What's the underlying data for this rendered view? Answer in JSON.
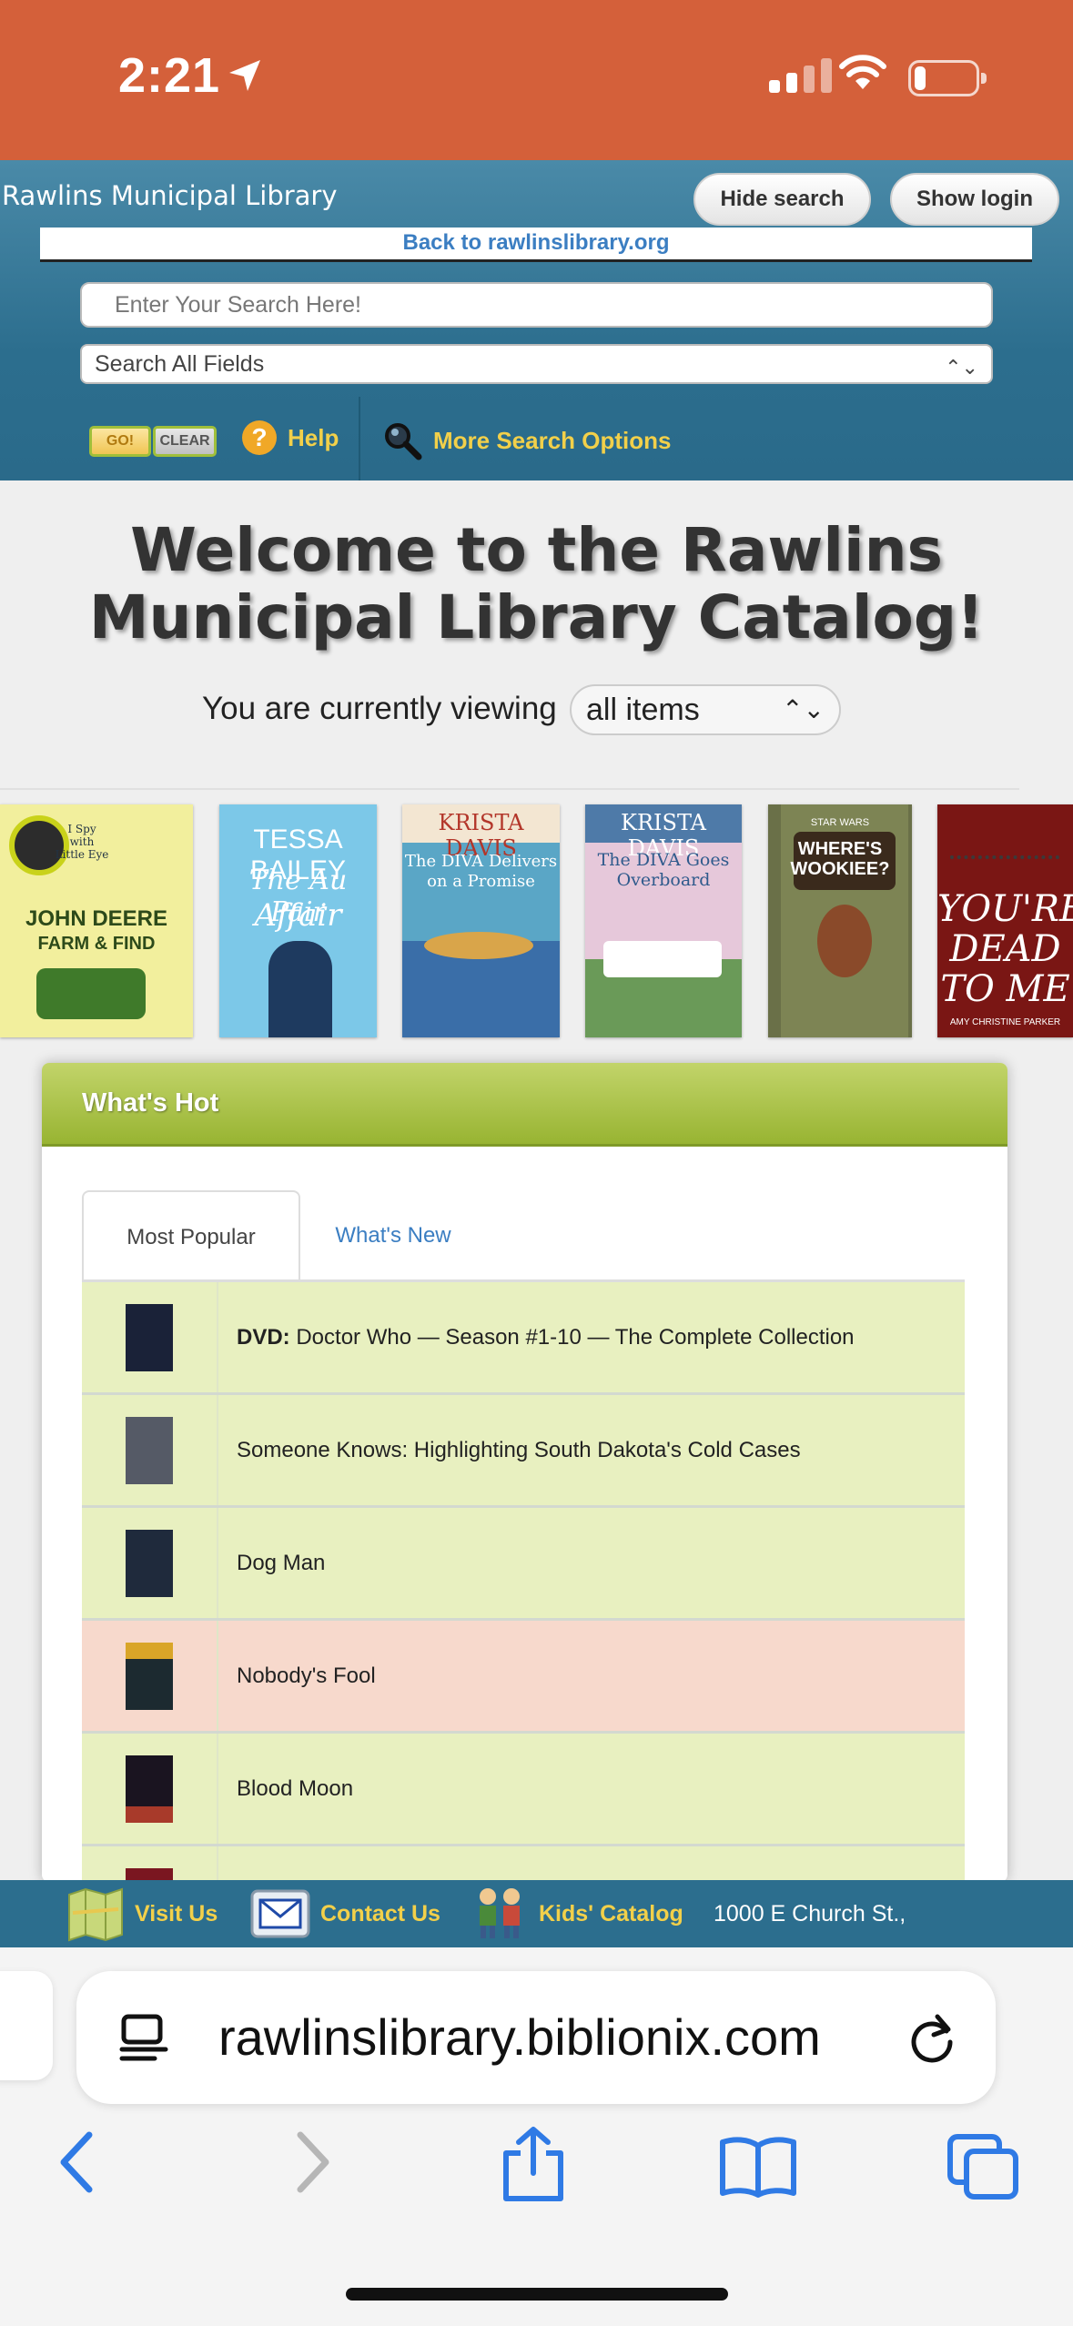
{
  "status": {
    "time": "2:21"
  },
  "header": {
    "library_name": "Rawlins Municipal Library",
    "hide_search": "Hide search",
    "show_login": "Show login",
    "back_link": "Back to rawlinslibrary.org",
    "search_placeholder": "Enter Your Search Here!",
    "search_scope": "Search All Fields",
    "go_label": "GO!",
    "clear_label": "CLEAR",
    "help_label": "Help",
    "more_options_label": "More Search Options"
  },
  "welcome": {
    "line1": "Welcome to the Rawlins",
    "line2": "Municipal Library Catalog!",
    "viewing_prefix": "You are currently viewing",
    "viewing_value": "all items"
  },
  "covers": [
    {
      "title_a": "JOHN DEERE",
      "title_b": "FARM & FIND",
      "small": "I Spy with Little Eye"
    },
    {
      "author": "TESSA BAILEY",
      "title_a": "The Au Pair",
      "title_b": "Affair"
    },
    {
      "author": "KRISTA DAVIS",
      "title_a": "The DIVA Delivers",
      "title_b": "on a Promise"
    },
    {
      "author": "KRISTA DAVIS",
      "title_a": "The DIVA Goes",
      "title_b": "Overboard"
    },
    {
      "title_a": "WHERE'S",
      "title_b": "WOOKIEE?",
      "small": "STAR WARS"
    },
    {
      "title_a": "YOU'RE",
      "title_b": "DEAD",
      "title_c": "TO ME",
      "author": "AMY CHRISTINE PARKER"
    }
  ],
  "whats_hot": {
    "heading": "What's Hot",
    "tabs": [
      "Most Popular",
      "What's New"
    ],
    "items": [
      {
        "prefix": "DVD:",
        "title": "Doctor Who — Season #1-10 — The Complete Collection",
        "thumb_color": "#1a2238"
      },
      {
        "prefix": "",
        "title": "Someone Knows: Highlighting South Dakota's Cold Cases",
        "thumb_color": "#555a66"
      },
      {
        "prefix": "",
        "title": "Dog Man",
        "thumb_color": "#1f2a3c"
      },
      {
        "prefix": "",
        "title": "Nobody's Fool",
        "thumb_color": "#1c2a30"
      },
      {
        "prefix": "",
        "title": "Blood Moon",
        "thumb_color": "#1a1420"
      }
    ]
  },
  "footer": {
    "visit_us": "Visit Us",
    "contact_us": "Contact Us",
    "kids_catalog": "Kids' Catalog",
    "address": "1000 E Church St.,"
  },
  "browser": {
    "url": "rawlinslibrary.biblionix.com"
  }
}
